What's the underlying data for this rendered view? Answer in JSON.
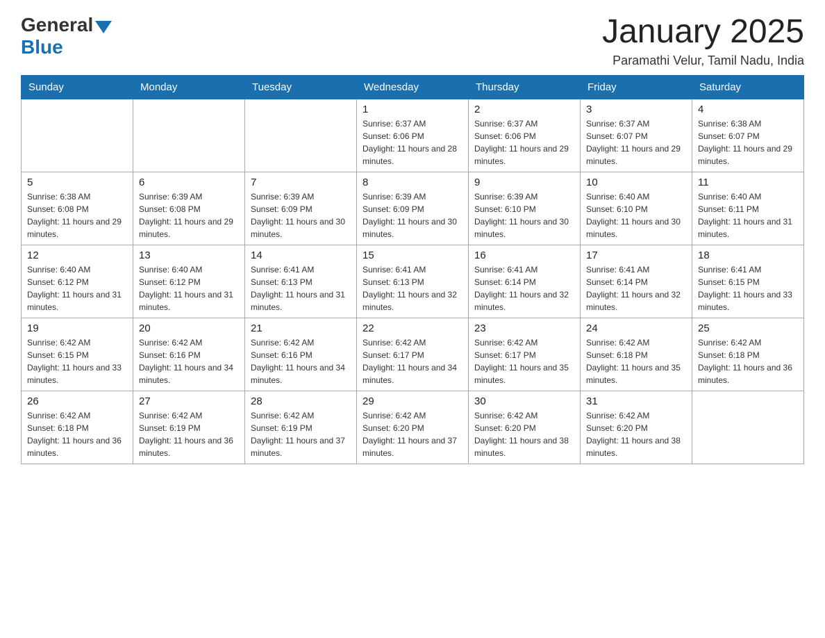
{
  "logo": {
    "general": "General",
    "blue": "Blue"
  },
  "title": "January 2025",
  "subtitle": "Paramathi Velur, Tamil Nadu, India",
  "days_of_week": [
    "Sunday",
    "Monday",
    "Tuesday",
    "Wednesday",
    "Thursday",
    "Friday",
    "Saturday"
  ],
  "weeks": [
    [
      {
        "day": "",
        "info": ""
      },
      {
        "day": "",
        "info": ""
      },
      {
        "day": "",
        "info": ""
      },
      {
        "day": "1",
        "info": "Sunrise: 6:37 AM\nSunset: 6:06 PM\nDaylight: 11 hours and 28 minutes."
      },
      {
        "day": "2",
        "info": "Sunrise: 6:37 AM\nSunset: 6:06 PM\nDaylight: 11 hours and 29 minutes."
      },
      {
        "day": "3",
        "info": "Sunrise: 6:37 AM\nSunset: 6:07 PM\nDaylight: 11 hours and 29 minutes."
      },
      {
        "day": "4",
        "info": "Sunrise: 6:38 AM\nSunset: 6:07 PM\nDaylight: 11 hours and 29 minutes."
      }
    ],
    [
      {
        "day": "5",
        "info": "Sunrise: 6:38 AM\nSunset: 6:08 PM\nDaylight: 11 hours and 29 minutes."
      },
      {
        "day": "6",
        "info": "Sunrise: 6:39 AM\nSunset: 6:08 PM\nDaylight: 11 hours and 29 minutes."
      },
      {
        "day": "7",
        "info": "Sunrise: 6:39 AM\nSunset: 6:09 PM\nDaylight: 11 hours and 30 minutes."
      },
      {
        "day": "8",
        "info": "Sunrise: 6:39 AM\nSunset: 6:09 PM\nDaylight: 11 hours and 30 minutes."
      },
      {
        "day": "9",
        "info": "Sunrise: 6:39 AM\nSunset: 6:10 PM\nDaylight: 11 hours and 30 minutes."
      },
      {
        "day": "10",
        "info": "Sunrise: 6:40 AM\nSunset: 6:10 PM\nDaylight: 11 hours and 30 minutes."
      },
      {
        "day": "11",
        "info": "Sunrise: 6:40 AM\nSunset: 6:11 PM\nDaylight: 11 hours and 31 minutes."
      }
    ],
    [
      {
        "day": "12",
        "info": "Sunrise: 6:40 AM\nSunset: 6:12 PM\nDaylight: 11 hours and 31 minutes."
      },
      {
        "day": "13",
        "info": "Sunrise: 6:40 AM\nSunset: 6:12 PM\nDaylight: 11 hours and 31 minutes."
      },
      {
        "day": "14",
        "info": "Sunrise: 6:41 AM\nSunset: 6:13 PM\nDaylight: 11 hours and 31 minutes."
      },
      {
        "day": "15",
        "info": "Sunrise: 6:41 AM\nSunset: 6:13 PM\nDaylight: 11 hours and 32 minutes."
      },
      {
        "day": "16",
        "info": "Sunrise: 6:41 AM\nSunset: 6:14 PM\nDaylight: 11 hours and 32 minutes."
      },
      {
        "day": "17",
        "info": "Sunrise: 6:41 AM\nSunset: 6:14 PM\nDaylight: 11 hours and 32 minutes."
      },
      {
        "day": "18",
        "info": "Sunrise: 6:41 AM\nSunset: 6:15 PM\nDaylight: 11 hours and 33 minutes."
      }
    ],
    [
      {
        "day": "19",
        "info": "Sunrise: 6:42 AM\nSunset: 6:15 PM\nDaylight: 11 hours and 33 minutes."
      },
      {
        "day": "20",
        "info": "Sunrise: 6:42 AM\nSunset: 6:16 PM\nDaylight: 11 hours and 34 minutes."
      },
      {
        "day": "21",
        "info": "Sunrise: 6:42 AM\nSunset: 6:16 PM\nDaylight: 11 hours and 34 minutes."
      },
      {
        "day": "22",
        "info": "Sunrise: 6:42 AM\nSunset: 6:17 PM\nDaylight: 11 hours and 34 minutes."
      },
      {
        "day": "23",
        "info": "Sunrise: 6:42 AM\nSunset: 6:17 PM\nDaylight: 11 hours and 35 minutes."
      },
      {
        "day": "24",
        "info": "Sunrise: 6:42 AM\nSunset: 6:18 PM\nDaylight: 11 hours and 35 minutes."
      },
      {
        "day": "25",
        "info": "Sunrise: 6:42 AM\nSunset: 6:18 PM\nDaylight: 11 hours and 36 minutes."
      }
    ],
    [
      {
        "day": "26",
        "info": "Sunrise: 6:42 AM\nSunset: 6:18 PM\nDaylight: 11 hours and 36 minutes."
      },
      {
        "day": "27",
        "info": "Sunrise: 6:42 AM\nSunset: 6:19 PM\nDaylight: 11 hours and 36 minutes."
      },
      {
        "day": "28",
        "info": "Sunrise: 6:42 AM\nSunset: 6:19 PM\nDaylight: 11 hours and 37 minutes."
      },
      {
        "day": "29",
        "info": "Sunrise: 6:42 AM\nSunset: 6:20 PM\nDaylight: 11 hours and 37 minutes."
      },
      {
        "day": "30",
        "info": "Sunrise: 6:42 AM\nSunset: 6:20 PM\nDaylight: 11 hours and 38 minutes."
      },
      {
        "day": "31",
        "info": "Sunrise: 6:42 AM\nSunset: 6:20 PM\nDaylight: 11 hours and 38 minutes."
      },
      {
        "day": "",
        "info": ""
      }
    ]
  ]
}
